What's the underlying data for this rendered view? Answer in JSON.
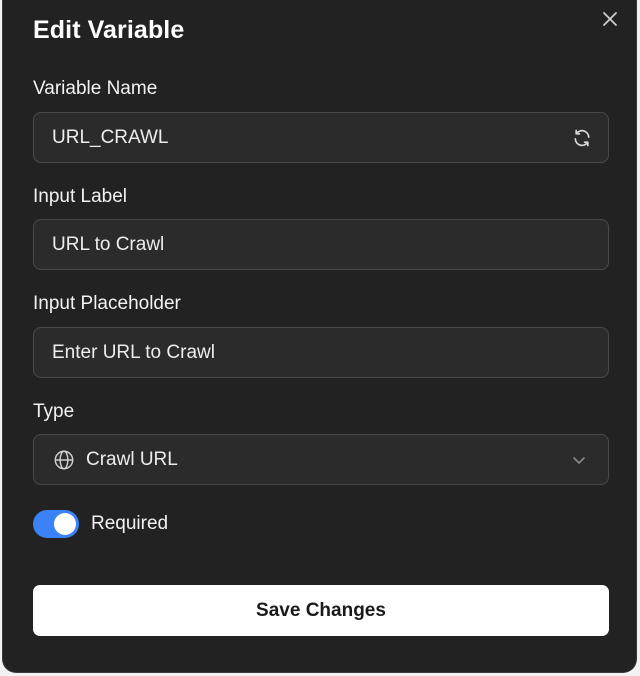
{
  "dialog": {
    "title": "Edit Variable"
  },
  "fields": {
    "variable_name": {
      "label": "Variable Name",
      "value": "URL_CRAWL"
    },
    "input_label": {
      "label": "Input Label",
      "value": "URL to Crawl"
    },
    "input_placeholder": {
      "label": "Input Placeholder",
      "value": "Enter URL to Crawl"
    },
    "type": {
      "label": "Type",
      "value": "Crawl URL"
    }
  },
  "required": {
    "label": "Required",
    "on": true
  },
  "actions": {
    "save_label": "Save Changes"
  },
  "icons": {
    "close": "close-icon",
    "refresh": "refresh-icon",
    "globe": "globe-icon",
    "chevron": "chevron-down-icon"
  },
  "colors": {
    "background": "#222222",
    "field": "#2b2b2b",
    "accent": "#3b82f6",
    "button": "#ffffff"
  }
}
